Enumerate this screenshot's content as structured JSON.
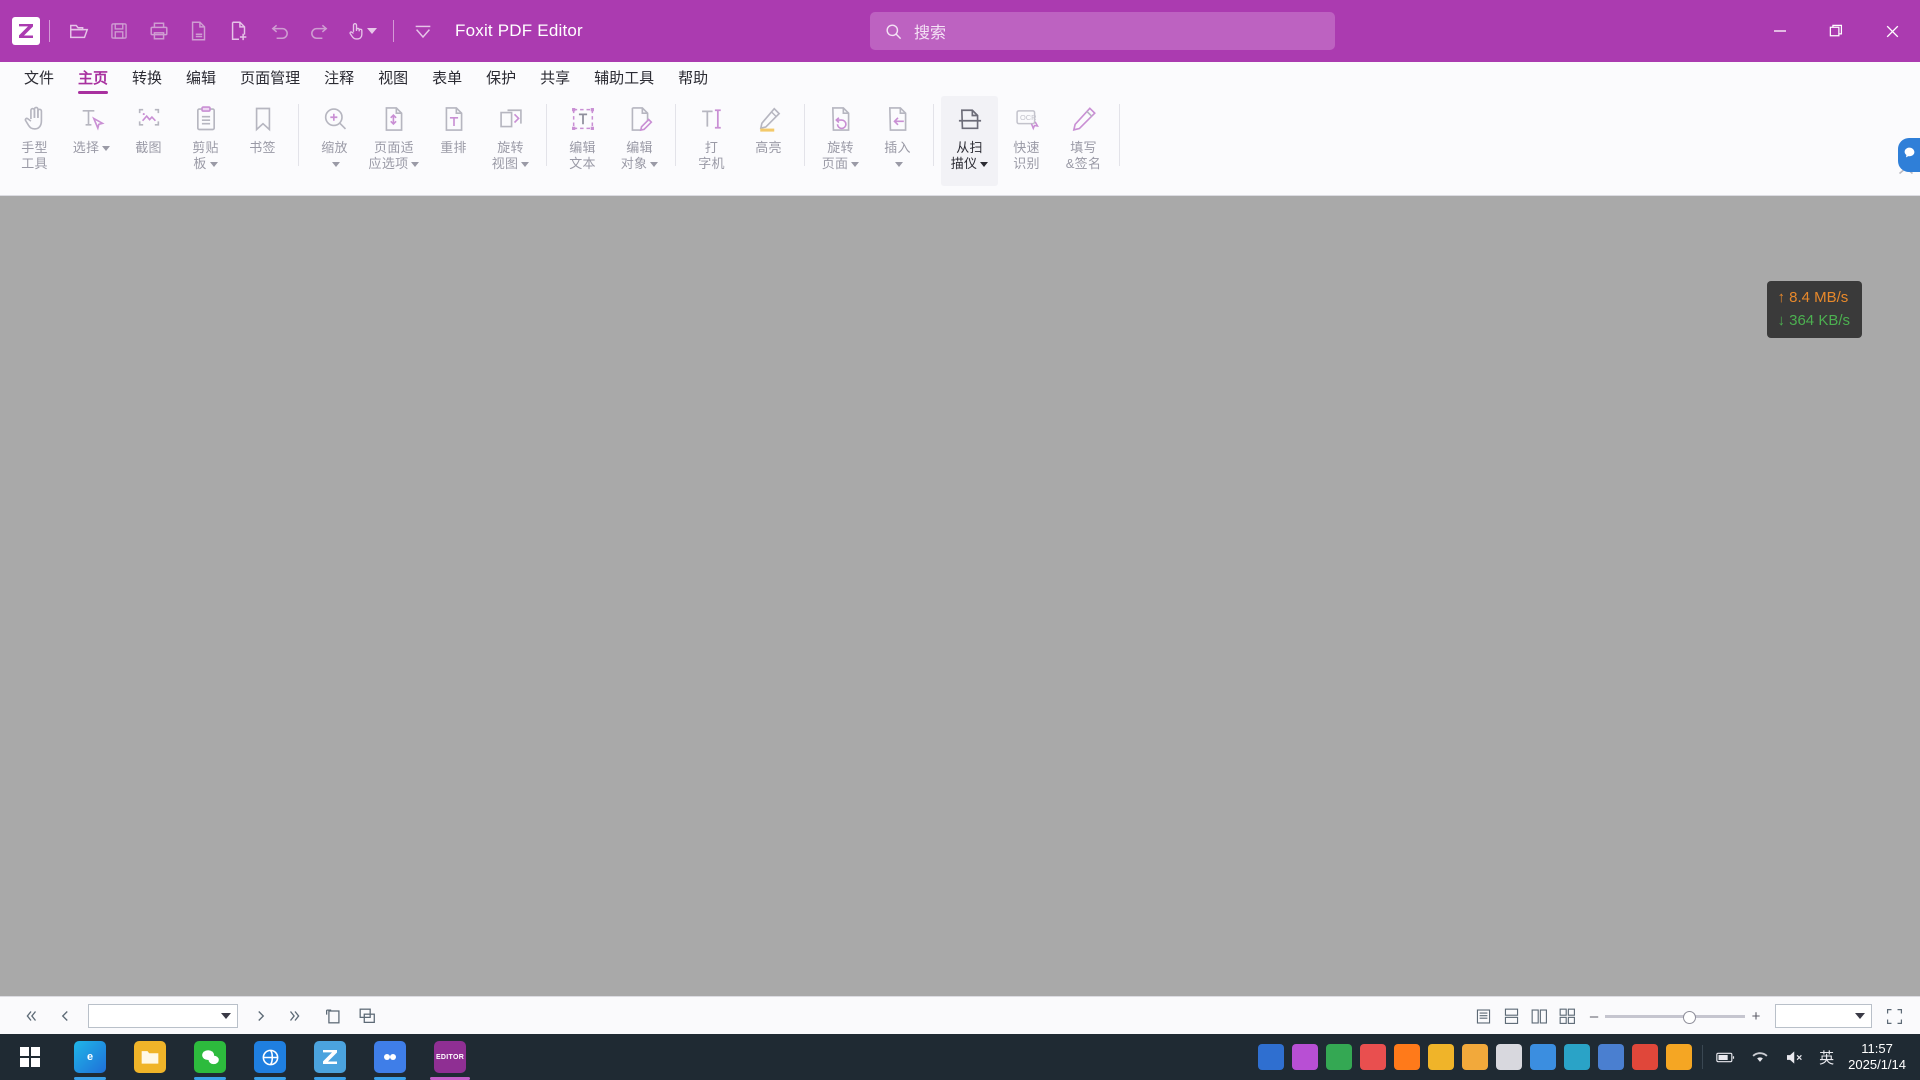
{
  "window": {
    "app_title": "Foxit PDF Editor",
    "logo_text": "Z",
    "quick_access": [
      {
        "name": "open-icon",
        "tooltip": "打开"
      },
      {
        "name": "save-icon",
        "tooltip": "保存"
      },
      {
        "name": "print-icon",
        "tooltip": "打印"
      },
      {
        "name": "email-icon",
        "tooltip": "邮件"
      },
      {
        "name": "new-document-icon",
        "tooltip": "新建"
      },
      {
        "name": "undo-icon",
        "tooltip": "撤销"
      },
      {
        "name": "redo-icon",
        "tooltip": "重做"
      },
      {
        "name": "touch-mode-icon",
        "tooltip": "触摸模式"
      },
      {
        "name": "customize-toolbar-icon",
        "tooltip": "自定义"
      }
    ],
    "controls": {
      "minimize": "最小化",
      "restore": "还原",
      "close": "关闭"
    }
  },
  "search": {
    "placeholder": "搜索",
    "icon": "search-icon"
  },
  "menubar": {
    "items": [
      {
        "label": "文件",
        "active": false
      },
      {
        "label": "主页",
        "active": true
      },
      {
        "label": "转换",
        "active": false
      },
      {
        "label": "编辑",
        "active": false
      },
      {
        "label": "页面管理",
        "active": false
      },
      {
        "label": "注释",
        "active": false
      },
      {
        "label": "视图",
        "active": false
      },
      {
        "label": "表单",
        "active": false
      },
      {
        "label": "保护",
        "active": false
      },
      {
        "label": "共享",
        "active": false
      },
      {
        "label": "辅助工具",
        "active": false
      },
      {
        "label": "帮助",
        "active": false
      }
    ]
  },
  "ribbon": {
    "groups": [
      {
        "items": [
          {
            "icon": "hand-tool-icon",
            "line1": "手型",
            "line2": "工具",
            "caret": false,
            "selected": false
          },
          {
            "icon": "select-text-icon",
            "line1": "选择",
            "line2": "",
            "caret": true,
            "selected": false
          },
          {
            "icon": "snapshot-icon",
            "line1": "截图",
            "line2": "",
            "caret": false,
            "selected": false
          },
          {
            "icon": "clipboard-icon",
            "line1": "剪贴",
            "line2": "板",
            "caret": true,
            "selected": false
          },
          {
            "icon": "bookmark-icon",
            "line1": "书签",
            "line2": "",
            "caret": false,
            "selected": false
          }
        ]
      },
      {
        "items": [
          {
            "icon": "zoom-icon",
            "line1": "缩放",
            "line2": "",
            "caret": true,
            "selected": false
          },
          {
            "icon": "fit-page-icon",
            "line1": "页面适",
            "line2": "应选项",
            "caret": true,
            "selected": false
          },
          {
            "icon": "reflow-icon",
            "line1": "重排",
            "line2": "",
            "caret": false,
            "selected": false
          },
          {
            "icon": "rotate-view-icon",
            "line1": "旋转",
            "line2": "视图",
            "caret": true,
            "selected": false
          }
        ]
      },
      {
        "items": [
          {
            "icon": "edit-text-icon",
            "line1": "编辑",
            "line2": "文本",
            "caret": false,
            "selected": false
          },
          {
            "icon": "edit-object-icon",
            "line1": "编辑",
            "line2": "对象",
            "caret": true,
            "selected": false
          }
        ]
      },
      {
        "items": [
          {
            "icon": "typewriter-icon",
            "line1": "打",
            "line2": "字机",
            "caret": false,
            "selected": false
          },
          {
            "icon": "highlight-icon",
            "line1": "高亮",
            "line2": "",
            "caret": false,
            "selected": false
          }
        ]
      },
      {
        "items": [
          {
            "icon": "rotate-pages-icon",
            "line1": "旋转",
            "line2": "页面",
            "caret": true,
            "selected": false
          },
          {
            "icon": "insert-pages-icon",
            "line1": "插入",
            "line2": "",
            "caret": true,
            "selected": false
          }
        ]
      },
      {
        "items": [
          {
            "icon": "from-scanner-icon",
            "line1": "从扫",
            "line2": "描仪",
            "caret": true,
            "selected": true
          },
          {
            "icon": "ocr-icon",
            "line1": "快速",
            "line2": "识别",
            "caret": false,
            "selected": false
          },
          {
            "icon": "fill-sign-icon",
            "line1": "填写",
            "line2": "&签名",
            "caret": false,
            "selected": false
          }
        ]
      }
    ],
    "side_tab_icon": "chat-bubble-icon"
  },
  "network_widget": {
    "upload": "↑ 8.4 MB/s",
    "download": "↓ 364 KB/s",
    "upload_color": "#e8892b",
    "download_color": "#4cb050"
  },
  "statusbar": {
    "nav": [
      {
        "name": "first-page-button",
        "glyph": "«"
      },
      {
        "name": "previous-page-button",
        "glyph": "‹"
      }
    ],
    "page_field_value": "",
    "nav_after": [
      {
        "name": "next-page-button",
        "glyph": "›"
      },
      {
        "name": "last-page-button",
        "glyph": "»"
      }
    ],
    "extra_icons": [
      "fit-width-icon",
      "fit-page-icon"
    ],
    "view_modes": [
      {
        "name": "single-page-view-icon"
      },
      {
        "name": "continuous-scroll-view-icon"
      },
      {
        "name": "two-page-view-icon"
      },
      {
        "name": "two-page-continuous-view-icon"
      }
    ],
    "zoom_out": "–",
    "zoom_in": "+",
    "zoom_value": "",
    "fullscreen_icon": "fullscreen-icon"
  },
  "taskbar": {
    "start": {
      "name": "start-button",
      "label": "Windows"
    },
    "pinned": [
      {
        "name": "taskbar-edge",
        "label": "e",
        "color": "#1b87d8",
        "underline": "#3aa0e8"
      },
      {
        "name": "taskbar-file-explorer",
        "label": "",
        "color": "#f5c043",
        "underline": ""
      },
      {
        "name": "taskbar-wechat",
        "label": "",
        "color": "#2dbb3d",
        "underline": "#3aa0e8"
      },
      {
        "name": "taskbar-browser",
        "label": "",
        "color": "#1f7fe0",
        "underline": "#3aa0e8"
      },
      {
        "name": "taskbar-foxit-reader",
        "label": "",
        "color": "#4ba3de",
        "underline": "#3aa0e8"
      },
      {
        "name": "taskbar-kdocs",
        "label": "",
        "color": "#3f7ee8",
        "underline": "#3aa0e8"
      },
      {
        "name": "taskbar-foxit-editor",
        "label": "EDITOR",
        "color": "#8f2f93",
        "underline": "#c25fc7"
      }
    ],
    "tray": [
      {
        "name": "tray-screenshot-icon",
        "color": "#2f6fd0"
      },
      {
        "name": "tray-meeting-icon",
        "color": "#b84fd4"
      },
      {
        "name": "tray-cloud-icon",
        "color": "#34a853"
      },
      {
        "name": "tray-paint-icon",
        "color": "#e94f4f"
      },
      {
        "name": "tray-music-icon",
        "color": "#ff7a1a"
      },
      {
        "name": "tray-folder-icon",
        "color": "#f0b429"
      },
      {
        "name": "tray-shield-icon",
        "color": "#f2a93b"
      },
      {
        "name": "tray-window-icon",
        "color": "#d8d8de"
      },
      {
        "name": "tray-video-icon",
        "color": "#3b8ee0"
      },
      {
        "name": "tray-globe-icon",
        "color": "#2aa3c7"
      },
      {
        "name": "tray-document-icon",
        "color": "#4a7fd0"
      },
      {
        "name": "tray-mail-icon",
        "color": "#e0473a"
      },
      {
        "name": "tray-flag-icon",
        "color": "#f5a623"
      }
    ],
    "system": {
      "battery_icon": "battery-icon",
      "wifi_icon": "wifi-icon",
      "volume_icon": "volume-mute-icon",
      "ime_label": "英",
      "time": "11:57",
      "date": "2025/1/14"
    }
  }
}
